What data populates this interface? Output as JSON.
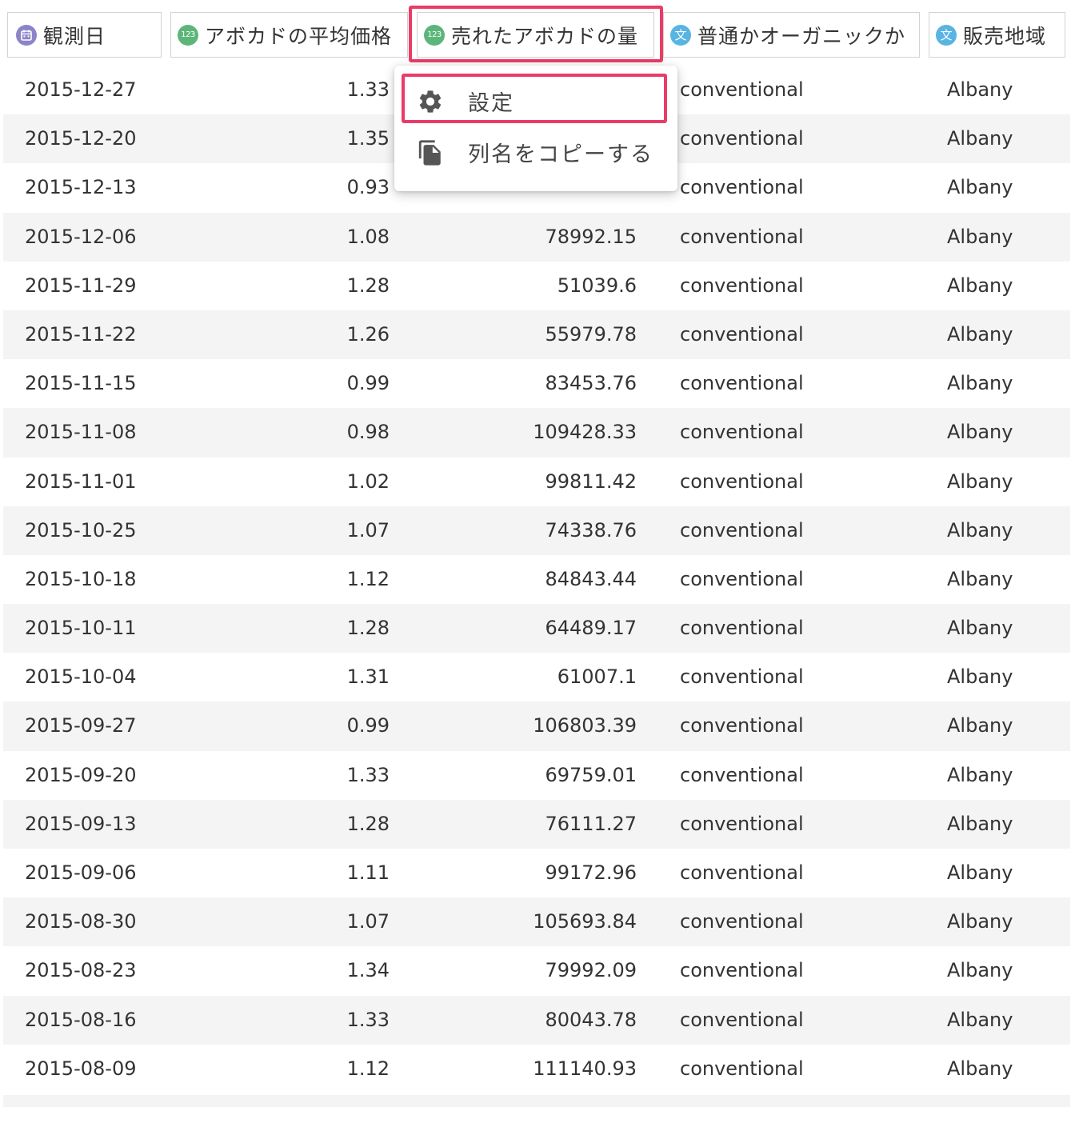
{
  "columns": [
    {
      "label": "観測日",
      "type_icon": "calendar-icon",
      "type_text": ""
    },
    {
      "label": "アボカドの平均価格",
      "type_icon": "number-type-icon",
      "type_text": "123"
    },
    {
      "label": "売れたアボカドの量",
      "type_icon": "number-type-icon",
      "type_text": "123"
    },
    {
      "label": "普通かオーガニックか",
      "type_icon": "text-type-icon",
      "type_text": "文"
    },
    {
      "label": "販売地域",
      "type_icon": "text-type-icon",
      "type_text": "文"
    }
  ],
  "context_menu": {
    "items": [
      {
        "label": "設定",
        "icon": "gear-icon"
      },
      {
        "label": "列名をコピーする",
        "icon": "copy-icon"
      }
    ]
  },
  "rows": [
    {
      "date": "2015-12-27",
      "price": "1.33",
      "volume": "",
      "type": "conventional",
      "region": "Albany"
    },
    {
      "date": "2015-12-20",
      "price": "1.35",
      "volume": "",
      "type": "conventional",
      "region": "Albany"
    },
    {
      "date": "2015-12-13",
      "price": "0.93",
      "volume": "",
      "type": "conventional",
      "region": "Albany"
    },
    {
      "date": "2015-12-06",
      "price": "1.08",
      "volume": "78992.15",
      "type": "conventional",
      "region": "Albany"
    },
    {
      "date": "2015-11-29",
      "price": "1.28",
      "volume": "51039.6",
      "type": "conventional",
      "region": "Albany"
    },
    {
      "date": "2015-11-22",
      "price": "1.26",
      "volume": "55979.78",
      "type": "conventional",
      "region": "Albany"
    },
    {
      "date": "2015-11-15",
      "price": "0.99",
      "volume": "83453.76",
      "type": "conventional",
      "region": "Albany"
    },
    {
      "date": "2015-11-08",
      "price": "0.98",
      "volume": "109428.33",
      "type": "conventional",
      "region": "Albany"
    },
    {
      "date": "2015-11-01",
      "price": "1.02",
      "volume": "99811.42",
      "type": "conventional",
      "region": "Albany"
    },
    {
      "date": "2015-10-25",
      "price": "1.07",
      "volume": "74338.76",
      "type": "conventional",
      "region": "Albany"
    },
    {
      "date": "2015-10-18",
      "price": "1.12",
      "volume": "84843.44",
      "type": "conventional",
      "region": "Albany"
    },
    {
      "date": "2015-10-11",
      "price": "1.28",
      "volume": "64489.17",
      "type": "conventional",
      "region": "Albany"
    },
    {
      "date": "2015-10-04",
      "price": "1.31",
      "volume": "61007.1",
      "type": "conventional",
      "region": "Albany"
    },
    {
      "date": "2015-09-27",
      "price": "0.99",
      "volume": "106803.39",
      "type": "conventional",
      "region": "Albany"
    },
    {
      "date": "2015-09-20",
      "price": "1.33",
      "volume": "69759.01",
      "type": "conventional",
      "region": "Albany"
    },
    {
      "date": "2015-09-13",
      "price": "1.28",
      "volume": "76111.27",
      "type": "conventional",
      "region": "Albany"
    },
    {
      "date": "2015-09-06",
      "price": "1.11",
      "volume": "99172.96",
      "type": "conventional",
      "region": "Albany"
    },
    {
      "date": "2015-08-30",
      "price": "1.07",
      "volume": "105693.84",
      "type": "conventional",
      "region": "Albany"
    },
    {
      "date": "2015-08-23",
      "price": "1.34",
      "volume": "79992.09",
      "type": "conventional",
      "region": "Albany"
    },
    {
      "date": "2015-08-16",
      "price": "1.33",
      "volume": "80043.78",
      "type": "conventional",
      "region": "Albany"
    },
    {
      "date": "2015-08-09",
      "price": "1.12",
      "volume": "111140.93",
      "type": "conventional",
      "region": "Albany"
    }
  ],
  "colors": {
    "highlight": "#e93c67",
    "date_type_badge": "#8c84c9",
    "number_type_badge": "#5cb67a",
    "text_type_badge": "#58b4e3",
    "row_stripe": "#f4f4f4"
  }
}
